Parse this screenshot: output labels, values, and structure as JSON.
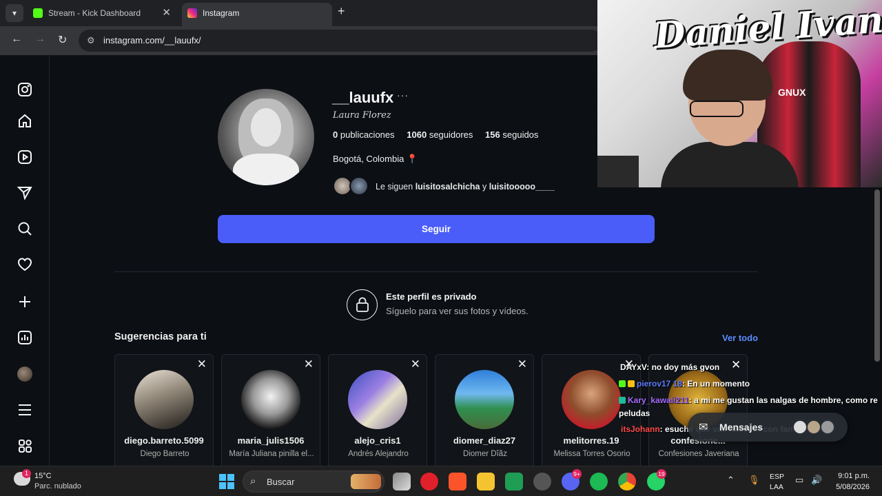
{
  "browser": {
    "tabs": [
      {
        "label": "Stream - Kick Dashboard",
        "favicon_color": "#53fc18"
      },
      {
        "label": "Instagram",
        "favicon_color": "#e1306c"
      }
    ],
    "url": "instagram.com/__lauufx/"
  },
  "sidebar": {
    "items": [
      "instagram-logo",
      "home",
      "reels",
      "messages",
      "search",
      "notifications",
      "create",
      "dashboard",
      "profile",
      "more",
      "threads"
    ]
  },
  "profile": {
    "username": "__lauufx",
    "more_label": "···",
    "full_name": "Laura Florez",
    "posts": {
      "value": "0",
      "label": "publicaciones"
    },
    "followers": {
      "value": "1060",
      "label": "seguidores"
    },
    "following": {
      "value": "156",
      "label": "seguidos"
    },
    "location": "Bogotá, Colombia",
    "followed_by_prefix": "Le siguen",
    "followed_by_1": "luisitosalchicha",
    "followed_by_join": "y",
    "followed_by_2": "luisitooooo____",
    "follow_button": "Seguir"
  },
  "private": {
    "title": "Este perfil es privado",
    "subtitle": "Síguelo para ver sus fotos y vídeos."
  },
  "suggestions": {
    "title": "Sugerencias para ti",
    "see_all": "Ver todo",
    "cards": [
      {
        "username": "diego.barreto.5099",
        "name": "Diego Barreto"
      },
      {
        "username": "maria_julis1506",
        "name": "María Juliana pinilla el..."
      },
      {
        "username": "alejo_cris1",
        "name": "Andrés Alejandro"
      },
      {
        "username": "diomer_diaz27",
        "name": "Diomer Dîãz"
      },
      {
        "username": "melitorres.19",
        "name": "Melissa Torres Osorio"
      },
      {
        "username": "confesione...",
        "name": "Confesiones Javeriana"
      }
    ]
  },
  "webcam": {
    "graffiti_text": "Daniel Ivan",
    "chair_text": "GNUX"
  },
  "chat": {
    "messages": [
      {
        "user": "DAYxV",
        "text": ": no doy más gvon"
      },
      {
        "user": "pierov17 18",
        "text": ": En un momento"
      },
      {
        "user": "Kary_kawaii211",
        "text": ": a mi me gustan las nalgas de hombre, como re"
      },
      {
        "user": "",
        "text": "peludas"
      },
      {
        "user": "itsJohann",
        "text": ": esuche que vas hacer irl con fans?"
      }
    ]
  },
  "messages_pill": {
    "label": "Mensajes"
  },
  "taskbar": {
    "weather_badge": "1",
    "temperature": "15°C",
    "weather": "Parc. nublado",
    "search_placeholder": "Buscar",
    "discord_badge": "9+",
    "whatsapp_badge": "19",
    "lang_line1": "ESP",
    "lang_line2": "LAA",
    "time": "9:01 p.m.",
    "date": "5/08/2026"
  }
}
